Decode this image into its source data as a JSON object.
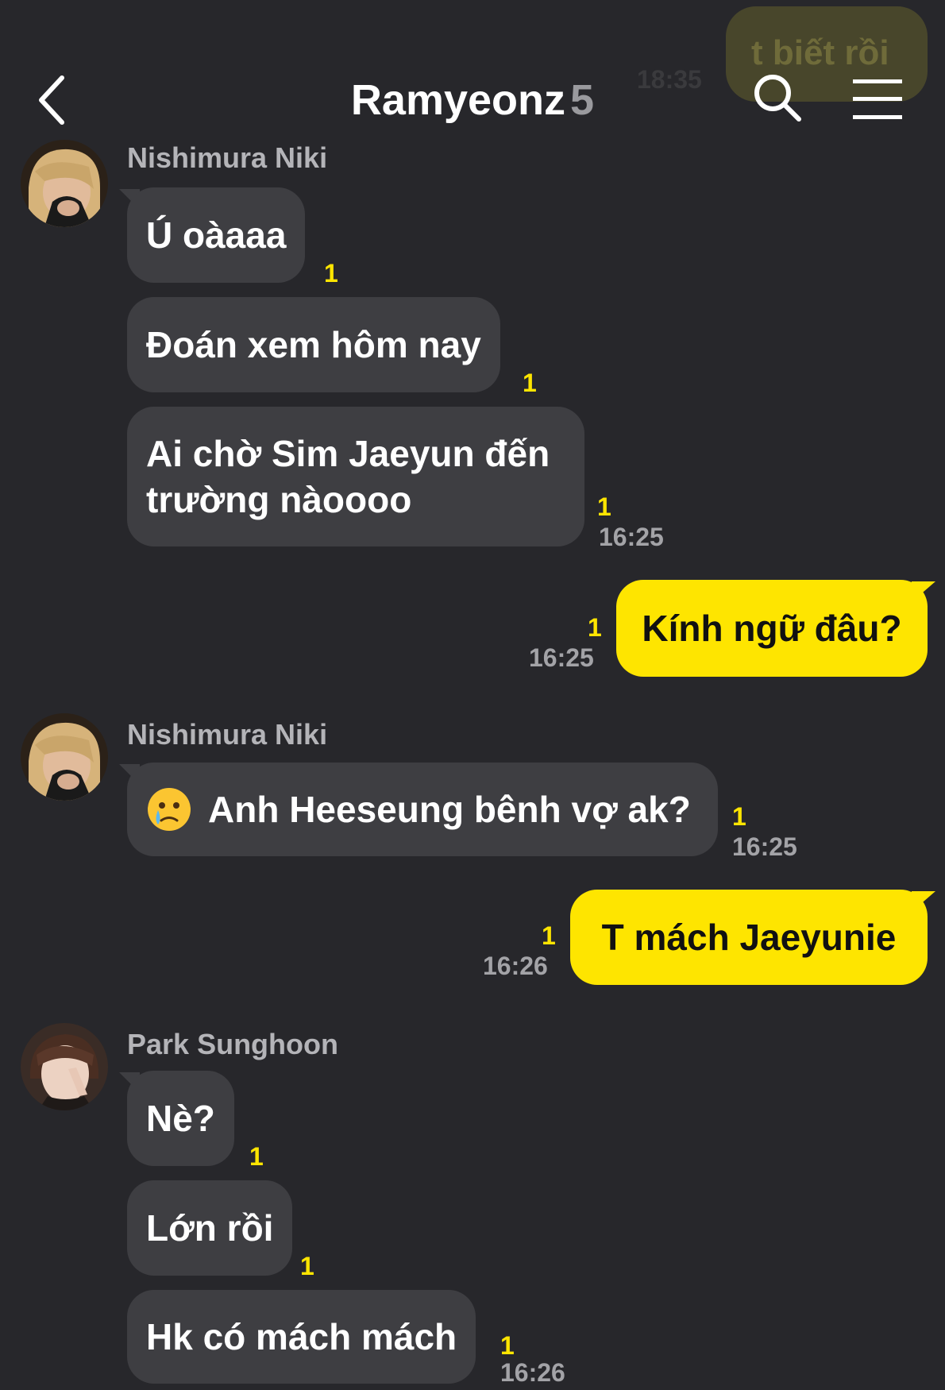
{
  "header": {
    "title": "Ramyeonz",
    "member_count": "5",
    "icons": [
      "chevron-left-icon",
      "search-icon",
      "menu-icon"
    ],
    "prev_message": {
      "text": "t biết rồi",
      "time": "18:35"
    }
  },
  "colors": {
    "background": "#27272b",
    "incoming_bubble": "#3e3e42",
    "outgoing_bubble": "#fee500",
    "unread": "#fee500"
  },
  "messages": [
    {
      "sender": "Nishimura Niki",
      "text": "Ú oàaaa",
      "unread": "1"
    },
    {
      "text": "Đoán xem hôm nay",
      "unread": "1"
    },
    {
      "text": "Ai chờ Sim Jaeyun đến trường nàoooo",
      "unread": "1",
      "time": "16:25"
    },
    {
      "text": "Kính ngữ đâu?",
      "unread": "1",
      "time": "16:25"
    },
    {
      "sender": "Nishimura Niki",
      "text": "Anh Heeseung bênh vợ ak?",
      "emoji": "crying-face-emoji",
      "unread": "1",
      "time": "16:25"
    },
    {
      "text": "T mách Jaeyunie",
      "unread": "1",
      "time": "16:26"
    },
    {
      "sender": "Park Sunghoon",
      "text": "Nè?",
      "unread": "1"
    },
    {
      "text": "Lớn rồi",
      "unread": "1"
    },
    {
      "text": "Hk có mách mách",
      "unread": "1",
      "time": "16:26"
    }
  ]
}
